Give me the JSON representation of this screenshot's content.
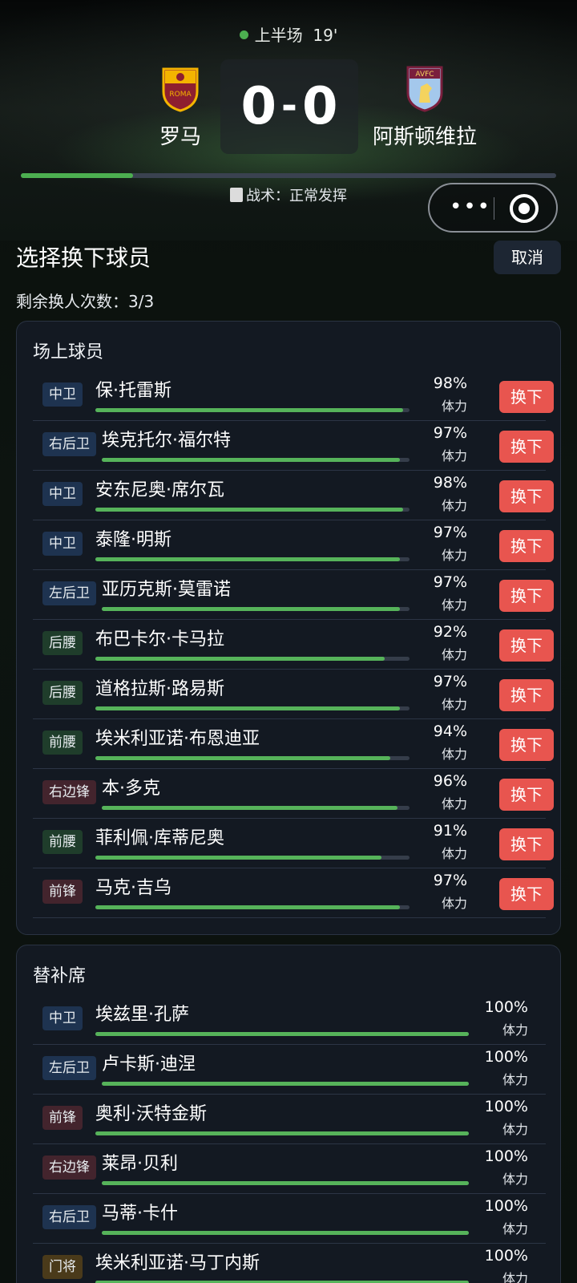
{
  "match": {
    "period": "上半场",
    "minute": "19'",
    "home": {
      "name": "罗马",
      "crest_text": "ROMA"
    },
    "away": {
      "name": "阿斯顿维拉",
      "crest_text": "AVFC"
    },
    "score_home": "0",
    "score_away": "0",
    "score_separator": "-",
    "progress_fraction": 0.21,
    "tactic_label": "战术：正常发挥"
  },
  "capsule": {
    "more_label": "•••"
  },
  "page": {
    "title": "选择换下球员",
    "cancel_label": "取消",
    "remaining_label": "剩余换人次数：3/3"
  },
  "onfield": {
    "title": "场上球员",
    "sub_label": "换下",
    "stamina_label": "体力",
    "players": [
      {
        "pos": "中卫",
        "name": "保·托雷斯",
        "pct": "98%",
        "level": 0.98,
        "group": "df"
      },
      {
        "pos": "右后卫",
        "name": "埃克托尔·福尔特",
        "pct": "97%",
        "level": 0.97,
        "group": "df"
      },
      {
        "pos": "中卫",
        "name": "安东尼奥·席尔瓦",
        "pct": "98%",
        "level": 0.98,
        "group": "df"
      },
      {
        "pos": "中卫",
        "name": "泰隆·明斯",
        "pct": "97%",
        "level": 0.97,
        "group": "df"
      },
      {
        "pos": "左后卫",
        "name": "亚历克斯·莫雷诺",
        "pct": "97%",
        "level": 0.97,
        "group": "df"
      },
      {
        "pos": "后腰",
        "name": "布巴卡尔·卡马拉",
        "pct": "92%",
        "level": 0.92,
        "group": "mf"
      },
      {
        "pos": "后腰",
        "name": "道格拉斯·路易斯",
        "pct": "97%",
        "level": 0.97,
        "group": "mf"
      },
      {
        "pos": "前腰",
        "name": "埃米利亚诺·布恩迪亚",
        "pct": "94%",
        "level": 0.94,
        "group": "mf"
      },
      {
        "pos": "右边锋",
        "name": "本·多克",
        "pct": "96%",
        "level": 0.96,
        "group": "fw"
      },
      {
        "pos": "前腰",
        "name": "菲利佩·库蒂尼奥",
        "pct": "91%",
        "level": 0.91,
        "group": "mf"
      },
      {
        "pos": "前锋",
        "name": "马克·吉乌",
        "pct": "97%",
        "level": 0.97,
        "group": "fw"
      }
    ]
  },
  "bench": {
    "title": "替补席",
    "stamina_label": "体力",
    "players": [
      {
        "pos": "中卫",
        "name": "埃兹里·孔萨",
        "pct": "100%",
        "level": 1.0,
        "group": "df"
      },
      {
        "pos": "左后卫",
        "name": "卢卡斯·迪涅",
        "pct": "100%",
        "level": 1.0,
        "group": "df"
      },
      {
        "pos": "前锋",
        "name": "奥利·沃特金斯",
        "pct": "100%",
        "level": 1.0,
        "group": "fw"
      },
      {
        "pos": "右边锋",
        "name": "莱昂·贝利",
        "pct": "100%",
        "level": 1.0,
        "group": "fw"
      },
      {
        "pos": "右后卫",
        "name": "马蒂·卡什",
        "pct": "100%",
        "level": 1.0,
        "group": "df"
      },
      {
        "pos": "门将",
        "name": "埃米利亚诺·马丁内斯",
        "pct": "100%",
        "level": 1.0,
        "group": "gk"
      }
    ]
  }
}
